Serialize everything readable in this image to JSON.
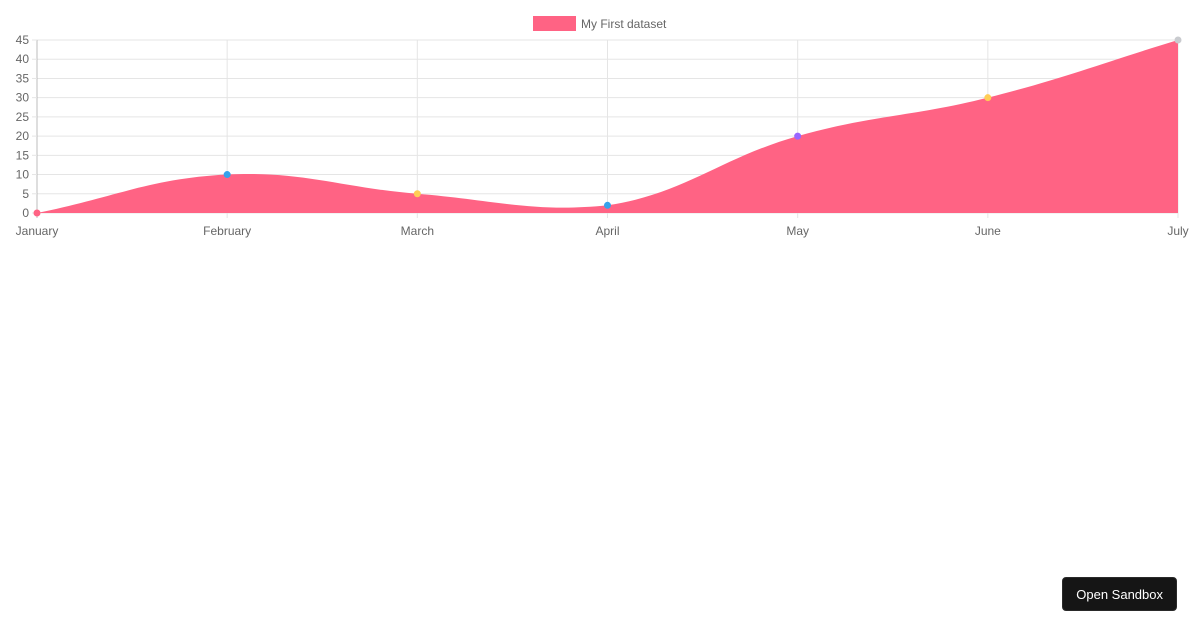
{
  "chart_data": {
    "type": "area",
    "title": "",
    "xlabel": "",
    "ylabel": "",
    "categories": [
      "January",
      "February",
      "March",
      "April",
      "May",
      "June",
      "July"
    ],
    "series": [
      {
        "name": "My First dataset",
        "values": [
          0,
          10,
          5,
          2,
          20,
          30,
          45
        ],
        "fill_color": "#ff6384",
        "point_colors": [
          "#ff6384",
          "#36a2eb",
          "#ffcd56",
          "#36a2eb",
          "#9966ff",
          "#ffcd56",
          "#c9cbcf"
        ]
      }
    ],
    "ylim": [
      0,
      45
    ],
    "yticks": [
      0,
      5,
      10,
      15,
      20,
      25,
      30,
      35,
      40,
      45
    ],
    "grid": true,
    "legend": "top-center",
    "curve": "smooth"
  },
  "colors": {
    "grid": "#e5e5e5",
    "axis": "#bdbdbd",
    "tick_text": "#666666"
  },
  "button": {
    "label": "Open Sandbox"
  }
}
